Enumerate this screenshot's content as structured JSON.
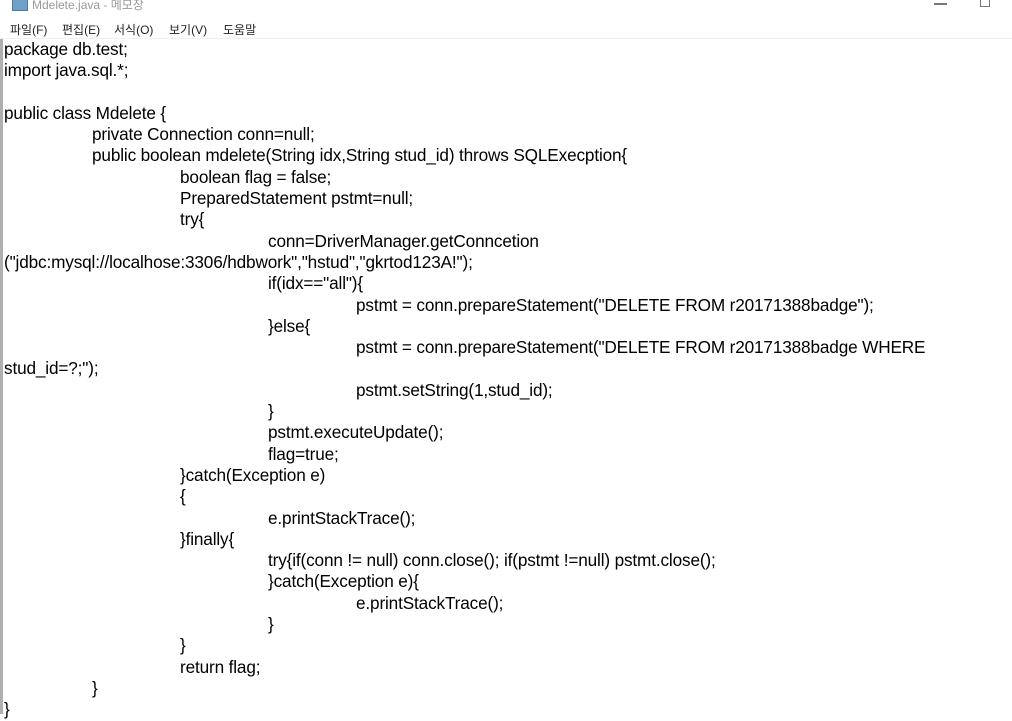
{
  "window": {
    "title": "Mdelete.java - 메모장"
  },
  "menu": [
    "파일(F)",
    "편집(E)",
    "서식(O)",
    "보기(V)",
    "도움말"
  ],
  "editor": {
    "lines": [
      "package db.test;",
      "import java.sql.*;",
      "",
      "public class Mdelete {",
      "\tprivate Connection conn=null;",
      "\tpublic boolean mdelete(String idx,String stud_id) throws SQLExecption{",
      "\t\tboolean flag = false;",
      "\t\tPreparedStatement pstmt=null;",
      "\t\ttry{",
      "\t\t\tconn=DriverManager.getConncetion",
      "(\"jdbc:mysql://localhose:3306/hdbwork\",\"hstud\",\"gkrtod123A!\");",
      "\t\t\tif(idx==\"all\"){",
      "\t\t\t\tpstmt = conn.prepareStatement(\"DELETE FROM r20171388badge\");",
      "\t\t\t}else{",
      "\t\t\t\tpstmt = conn.prepareStatement(\"DELETE FROM r20171388badge WHERE",
      "stud_id=?;\");",
      "\t\t\t\tpstmt.setString(1,stud_id);",
      "\t\t\t}",
      "\t\t\tpstmt.executeUpdate();",
      "\t\t\tflag=true;",
      "\t\t}catch(Exception e)",
      "\t\t{",
      "\t\t\te.printStackTrace();",
      "\t\t}finally{",
      "\t\t\ttry{if(conn != null) conn.close(); if(pstmt !=null) pstmt.close();",
      "\t\t\t}catch(Exception e){",
      "\t\t\t\te.printStackTrace();",
      "\t\t\t}",
      "\t\t}",
      "\t\treturn flag;",
      "\t}",
      "}"
    ]
  }
}
